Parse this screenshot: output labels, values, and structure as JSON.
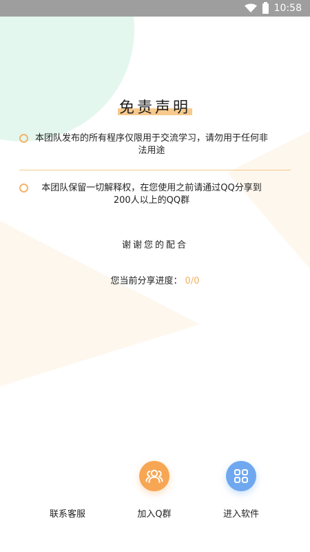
{
  "status_bar": {
    "time": "10:58",
    "icons": [
      "wifi-icon",
      "battery-icon"
    ]
  },
  "disclaimer": {
    "title": "免责声明",
    "items": [
      {
        "text": "本团队发布的所有程序仅限用于交流学习，请勿用于任何非法用途"
      },
      {
        "text": "本团队保留一切解释权，在您使用之前请通过QQ分享到200人以上的QQ群"
      }
    ],
    "thanks": "谢谢您的配合",
    "progress_label": "您当前分享进度：",
    "progress_value": "0/0"
  },
  "actions": [
    {
      "label": "联系客服",
      "icon": "none"
    },
    {
      "label": "加入Q群",
      "icon": "group-icon"
    },
    {
      "label": "进入软件",
      "icon": "apps-icon"
    }
  ],
  "colors": {
    "accent_orange": "#f7a654",
    "accent_blue": "#6fa8ef",
    "highlight": "#f7c98d",
    "status_bar": "#9e9e9e",
    "bg_circle": "#e3f7ee"
  }
}
